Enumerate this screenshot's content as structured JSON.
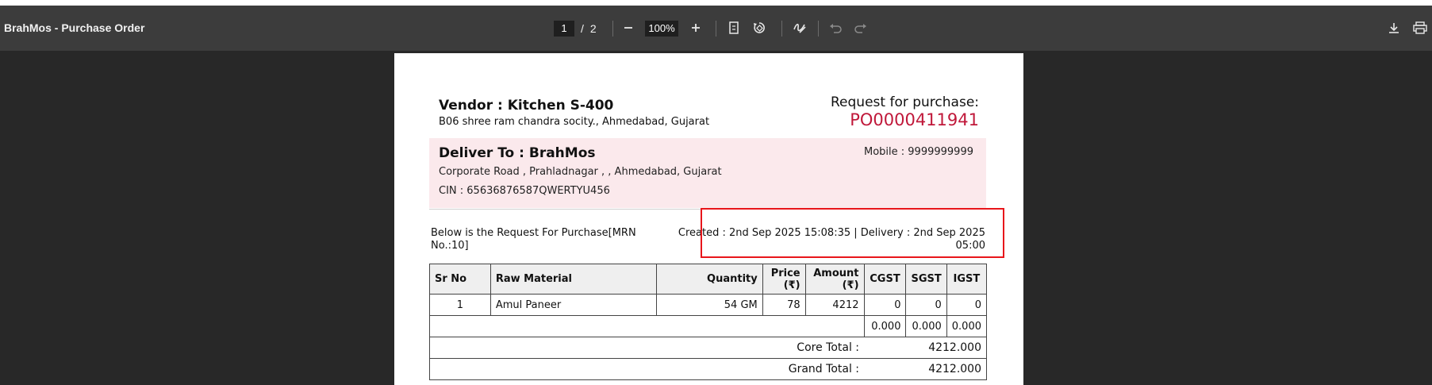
{
  "viewer": {
    "title": "BrahMos - Purchase Order",
    "page_current": "1",
    "page_separator": "/",
    "page_total": "2",
    "zoom": "100%",
    "icons": [
      "minus-icon",
      "plus-icon",
      "fit-page-icon",
      "rotate-icon",
      "draw-icon",
      "undo-icon",
      "redo-icon",
      "download-icon",
      "print-icon"
    ]
  },
  "document": {
    "vendor_title": "Vendor : Kitchen S-400",
    "vendor_address": "B06 shree ram chandra socity., Ahmedabad, Gujarat",
    "request_label": "Request for purchase:",
    "po_number": "PO0000411941",
    "deliver_title": "Deliver To : BrahMos",
    "deliver_address": "Corporate Road , Prahladnagar , , Ahmedabad, Gujarat",
    "cin": "CIN : 65636876587QWERTYU456",
    "mobile": "Mobile : 9999999999",
    "below_text": "Below is the Request For Purchase[MRN No.:10]",
    "created_text": "Created : 2nd Sep 2025 15:08:35 | Delivery : 2nd Sep 2025 05:00",
    "table": {
      "headers": {
        "sr": "Sr No",
        "material": "Raw Material",
        "quantity": "Quantity",
        "price": "Price (₹)",
        "amount": "Amount (₹)",
        "cgst": "CGST",
        "sgst": "SGST",
        "igst": "IGST"
      },
      "rows": [
        {
          "sr": "1",
          "material": "Amul Paneer",
          "quantity": "54 GM",
          "price": "78",
          "amount": "4212",
          "cgst": "0",
          "sgst": "0",
          "igst": "0"
        }
      ],
      "tax_sums": {
        "cgst": "0.000",
        "sgst": "0.000",
        "igst": "0.000"
      },
      "core_total_label": "Core Total :",
      "core_total_value": "4212.000",
      "grand_total_label": "Grand Total :",
      "grand_total_value": "4212.000"
    }
  },
  "colors": {
    "po_number": "#c0183a",
    "deliver_bg": "#fbe9ec",
    "highlight_border": "#e8161b",
    "toolbar_bg": "#3c3c3c",
    "viewer_bg": "#282828"
  }
}
